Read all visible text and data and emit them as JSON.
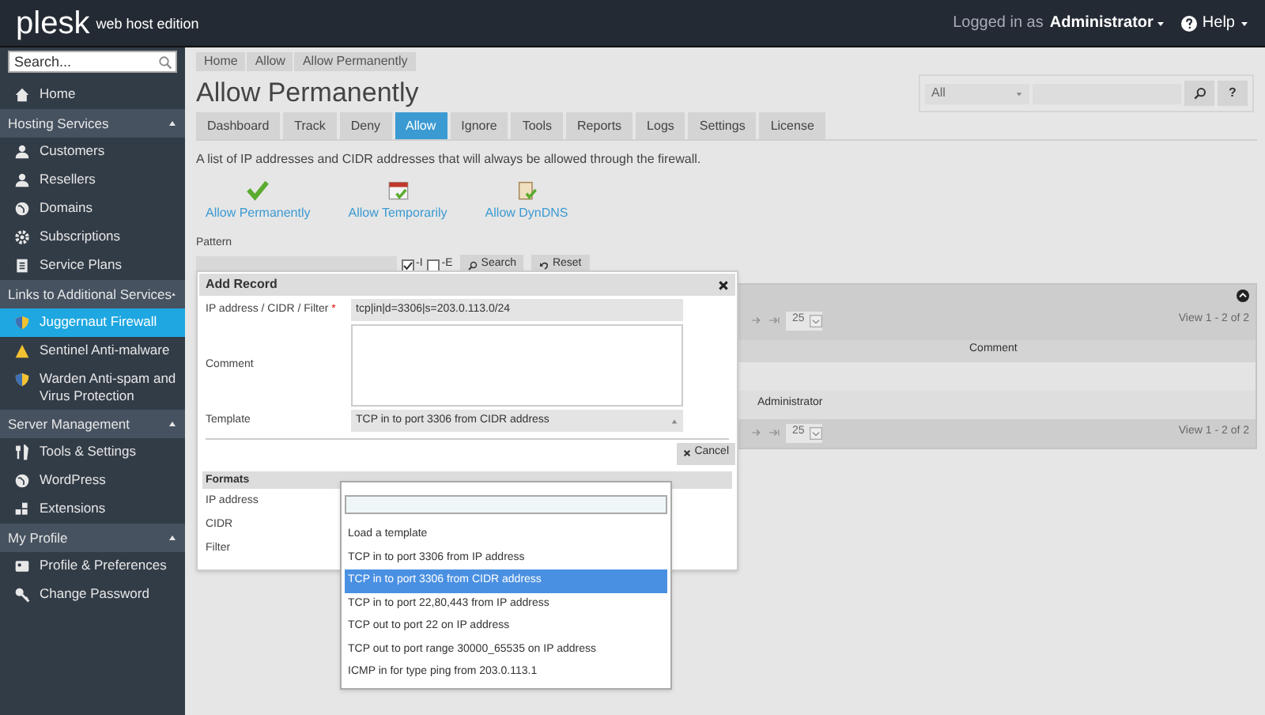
{
  "header": {
    "logo": "plesk",
    "edition": "web host edition",
    "logged_in_label": "Logged in as",
    "user": "Administrator",
    "help": "Help"
  },
  "sidebar": {
    "search_placeholder": "Search...",
    "sections": [
      {
        "kind": "item",
        "label": "Home",
        "selected": false
      },
      {
        "kind": "section",
        "label": "Hosting Services",
        "expanded": true,
        "items": [
          {
            "label": "Customers",
            "selected": false
          },
          {
            "label": "Resellers",
            "selected": false
          },
          {
            "label": "Domains",
            "selected": false
          },
          {
            "label": "Subscriptions",
            "selected": false
          },
          {
            "label": "Service Plans",
            "selected": false
          }
        ]
      },
      {
        "kind": "section",
        "label": "Links to Additional Services",
        "expanded": true,
        "items": [
          {
            "label": "Juggernaut Firewall",
            "selected": true
          },
          {
            "label": "Sentinel Anti-malware",
            "selected": false
          },
          {
            "label": "Warden Anti-spam and Virus Protection",
            "selected": false
          }
        ]
      },
      {
        "kind": "section",
        "label": "Server Management",
        "expanded": true,
        "items": [
          {
            "label": "Tools & Settings",
            "selected": false
          },
          {
            "label": "WordPress",
            "selected": false
          },
          {
            "label": "Extensions",
            "selected": false
          }
        ]
      },
      {
        "kind": "section",
        "label": "My Profile",
        "expanded": true,
        "items": [
          {
            "label": "Profile & Preferences",
            "selected": false
          },
          {
            "label": "Change Password",
            "selected": false
          }
        ]
      }
    ]
  },
  "breadcrumbs": [
    "Home",
    "Allow",
    "Allow Permanently"
  ],
  "title": "Allow Permanently",
  "top_search": {
    "scope": "All",
    "help": "?"
  },
  "tabs": [
    {
      "label": "Dashboard",
      "selected": false
    },
    {
      "label": "Track",
      "selected": false
    },
    {
      "label": "Deny",
      "selected": false
    },
    {
      "label": "Allow",
      "selected": true
    },
    {
      "label": "Ignore",
      "selected": false
    },
    {
      "label": "Tools",
      "selected": false
    },
    {
      "label": "Reports",
      "selected": false
    },
    {
      "label": "Logs",
      "selected": false
    },
    {
      "label": "Settings",
      "selected": false
    },
    {
      "label": "License",
      "selected": false
    }
  ],
  "description": "A list of IP addresses and CIDR addresses that will always be allowed through the firewall.",
  "actions": [
    "Allow Permanently",
    "Allow Temporarily",
    "Allow DynDNS"
  ],
  "pattern": {
    "label": "Pattern",
    "options": [
      {
        "label": "-I",
        "checked": true
      },
      {
        "label": "-E",
        "checked": false
      }
    ],
    "search": "Search",
    "reset": "Reset"
  },
  "grid": {
    "pagers": [
      {
        "page_size": "25",
        "view": "View 1 - 2 of 2"
      },
      {
        "page_size": "25",
        "view": "View 1 - 2 of 2"
      }
    ],
    "column": "Comment",
    "cell": "Administrator"
  },
  "dialog": {
    "title": "Add Record",
    "fields": [
      {
        "label": "IP address / CIDR / Filter",
        "required_mark": "*",
        "value": "tcp|in|d=3306|s=203.0.113.0/24"
      },
      {
        "label": "Comment"
      },
      {
        "label": "Template",
        "value": "TCP in to port 3306 from CIDR address"
      }
    ],
    "cancel": "Cancel",
    "formats_title": "Formats",
    "formats": [
      "IP address",
      "CIDR",
      "Filter"
    ],
    "dropdown": [
      {
        "label": "Load a template",
        "selected": false
      },
      {
        "label": "TCP in to port 3306 from IP address",
        "selected": false
      },
      {
        "label": "TCP in to port 3306 from CIDR address",
        "selected": true
      },
      {
        "label": "TCP in to port 22,80,443 from IP address",
        "selected": false
      },
      {
        "label": "TCP out to port 22 on IP address",
        "selected": false
      },
      {
        "label": "TCP out to port range 30000_65535 on IP address",
        "selected": false
      },
      {
        "label": "ICMP in for type ping from 203.0.113.1",
        "selected": false
      }
    ]
  }
}
